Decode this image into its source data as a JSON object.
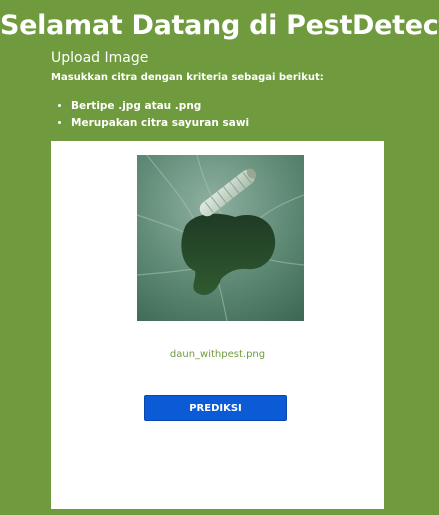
{
  "header": {
    "title": "Selamat Datang di PestDetect",
    "subtitle": "Upload Image",
    "instructions": "Masukkan citra dengan kriteria sebagai berikut:"
  },
  "requirements": [
    "Bertipe .jpg atau .png",
    "Merupakan citra sayuran sawi"
  ],
  "upload": {
    "preview_image": "caterpillar-on-mustard-leaf-photo",
    "filename": "daun_withpest.png",
    "predict_label": "PREDIKSI"
  },
  "colors": {
    "background": "#6f9b3e",
    "card": "#ffffff",
    "button": "#0b5bd7",
    "filename_text": "#6f9b3e"
  }
}
